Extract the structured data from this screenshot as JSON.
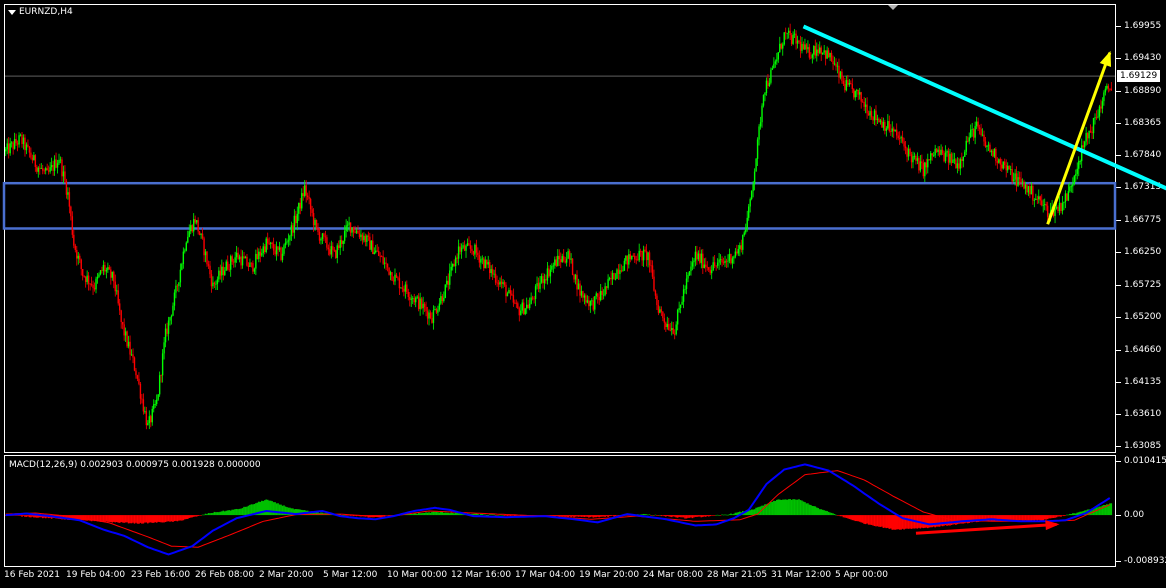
{
  "symbol": "EURNZD,H4",
  "macd_label": "MACD(12,26,9) 0.002903 0.000975 0.001928 0.000000",
  "current_price": "1.69129",
  "colors": {
    "bull": "#00ff00",
    "bear": "#ff0000",
    "resistance_line": "#00ffff",
    "zone_border": "#4a6fd0",
    "yellow_arrow": "#ffff00",
    "red_arrow": "#ff0000",
    "macd_line": "#0000ff",
    "signal_line": "#ff0000"
  },
  "chart_data": [
    {
      "type": "candlestick",
      "title": "EURNZD,H4",
      "ylim": [
        1.6299,
        1.7029
      ],
      "y_ticks": [
        "1.69955",
        "1.69430",
        "1.68890",
        "1.68365",
        "1.67840",
        "1.67315",
        "1.66775",
        "1.66250",
        "1.65725",
        "1.65200",
        "1.64660",
        "1.64135",
        "1.63610",
        "1.63085"
      ],
      "x_ticks": [
        "16 Feb 2021",
        "19 Feb 04:00",
        "23 Feb 16:00",
        "26 Feb 08:00",
        "2 Mar 20:00",
        "5 Mar 12:00",
        "10 Mar 00:00",
        "12 Mar 16:00",
        "17 Mar 04:00",
        "19 Mar 20:00",
        "24 Mar 08:00",
        "28 Mar 21:05",
        "31 Mar 12:00",
        "5 Apr 00:00"
      ],
      "path_anchors": [
        [
          0,
          1.679
        ],
        [
          10,
          1.681
        ],
        [
          20,
          1.677
        ],
        [
          28,
          1.675
        ],
        [
          36,
          1.678
        ],
        [
          42,
          1.672
        ],
        [
          46,
          1.664
        ],
        [
          52,
          1.659
        ],
        [
          60,
          1.657
        ],
        [
          66,
          1.66
        ],
        [
          73,
          1.658
        ],
        [
          78,
          1.651
        ],
        [
          88,
          1.643
        ],
        [
          96,
          1.634
        ],
        [
          102,
          1.638
        ],
        [
          108,
          1.649
        ],
        [
          115,
          1.656
        ],
        [
          122,
          1.665
        ],
        [
          128,
          1.668
        ],
        [
          134,
          1.663
        ],
        [
          140,
          1.657
        ],
        [
          148,
          1.66
        ],
        [
          156,
          1.662
        ],
        [
          166,
          1.66
        ],
        [
          176,
          1.664
        ],
        [
          186,
          1.662
        ],
        [
          196,
          1.668
        ],
        [
          202,
          1.673
        ],
        [
          210,
          1.666
        ],
        [
          222,
          1.662
        ],
        [
          232,
          1.667
        ],
        [
          242,
          1.665
        ],
        [
          252,
          1.662
        ],
        [
          264,
          1.658
        ],
        [
          276,
          1.655
        ],
        [
          288,
          1.652
        ],
        [
          298,
          1.657
        ],
        [
          306,
          1.663
        ],
        [
          316,
          1.663
        ],
        [
          326,
          1.66
        ],
        [
          336,
          1.657
        ],
        [
          346,
          1.653
        ],
        [
          354,
          1.654
        ],
        [
          362,
          1.658
        ],
        [
          372,
          1.661
        ],
        [
          380,
          1.662
        ],
        [
          388,
          1.656
        ],
        [
          396,
          1.654
        ],
        [
          404,
          1.656
        ],
        [
          414,
          1.66
        ],
        [
          424,
          1.662
        ],
        [
          434,
          1.662
        ],
        [
          440,
          1.654
        ],
        [
          446,
          1.651
        ],
        [
          452,
          1.65
        ],
        [
          458,
          1.656
        ],
        [
          466,
          1.662
        ],
        [
          476,
          1.66
        ],
        [
          486,
          1.661
        ],
        [
          496,
          1.663
        ],
        [
          502,
          1.669
        ],
        [
          508,
          1.68
        ],
        [
          512,
          1.689
        ],
        [
          518,
          1.692
        ],
        [
          526,
          1.698
        ],
        [
          534,
          1.697
        ],
        [
          542,
          1.695
        ],
        [
          550,
          1.696
        ],
        [
          558,
          1.694
        ],
        [
          566,
          1.69
        ],
        [
          576,
          1.688
        ],
        [
          586,
          1.685
        ],
        [
          596,
          1.683
        ],
        [
          604,
          1.681
        ],
        [
          612,
          1.678
        ],
        [
          620,
          1.676
        ],
        [
          628,
          1.679
        ],
        [
          636,
          1.678
        ],
        [
          644,
          1.677
        ],
        [
          650,
          1.681
        ],
        [
          656,
          1.683
        ],
        [
          662,
          1.68
        ],
        [
          670,
          1.678
        ],
        [
          680,
          1.675
        ],
        [
          690,
          1.673
        ],
        [
          698,
          1.671
        ],
        [
          705,
          1.669
        ],
        [
          712,
          1.67
        ],
        [
          718,
          1.672
        ],
        [
          724,
          1.677
        ],
        [
          730,
          1.681
        ],
        [
          736,
          1.684
        ],
        [
          742,
          1.688
        ],
        [
          747,
          1.69
        ]
      ],
      "resistance_line": {
        "start": [
          539,
          1.6994
        ],
        "end": [
          845,
          1.6664
        ]
      },
      "support_zone": {
        "top": 1.6738,
        "bottom": 1.6664
      },
      "yellow_arrow": {
        "start": [
          704,
          1.6671
        ],
        "end": [
          746,
          1.6951
        ]
      }
    },
    {
      "type": "macd",
      "title": "MACD(12,26,9) 0.002903 0.000975 0.001928 0.000000",
      "ylim": [
        -0.009832,
        0.011415
      ],
      "y_ticks": [
        "0.010415",
        "0.00",
        "-0.008932"
      ],
      "macd_anchors": [
        [
          0,
          0.0
        ],
        [
          14,
          0.0003
        ],
        [
          30,
          -0.0002
        ],
        [
          50,
          -0.001
        ],
        [
          66,
          -0.0028
        ],
        [
          80,
          -0.004
        ],
        [
          96,
          -0.0062
        ],
        [
          110,
          -0.0076
        ],
        [
          126,
          -0.006
        ],
        [
          140,
          -0.003
        ],
        [
          156,
          -0.0006
        ],
        [
          176,
          0.0008
        ],
        [
          196,
          0.0002
        ],
        [
          214,
          0.0008
        ],
        [
          226,
          -0.0002
        ],
        [
          238,
          -0.0006
        ],
        [
          250,
          -0.0008
        ],
        [
          262,
          -0.0002
        ],
        [
          276,
          0.0008
        ],
        [
          290,
          0.0014
        ],
        [
          300,
          0.001
        ],
        [
          316,
          -0.0002
        ],
        [
          338,
          -0.0004
        ],
        [
          364,
          -0.0002
        ],
        [
          384,
          -0.0008
        ],
        [
          400,
          -0.0014
        ],
        [
          420,
          0.0002
        ],
        [
          446,
          -0.0008
        ],
        [
          466,
          -0.002
        ],
        [
          480,
          -0.0018
        ],
        [
          492,
          -0.0006
        ],
        [
          502,
          0.001
        ],
        [
          514,
          0.006
        ],
        [
          526,
          0.0088
        ],
        [
          540,
          0.0098
        ],
        [
          556,
          0.0086
        ],
        [
          572,
          0.0058
        ],
        [
          590,
          0.0022
        ],
        [
          606,
          -0.0006
        ],
        [
          624,
          -0.0018
        ],
        [
          646,
          -0.0012
        ],
        [
          666,
          -0.0008
        ],
        [
          686,
          -0.0012
        ],
        [
          702,
          -0.0012
        ],
        [
          716,
          -0.001
        ],
        [
          730,
          0.0004
        ],
        [
          746,
          0.0033
        ]
      ],
      "signal_anchors": [
        [
          0,
          0.0002
        ],
        [
          20,
          0.0004
        ],
        [
          46,
          -0.0003
        ],
        [
          70,
          -0.0015
        ],
        [
          96,
          -0.0042
        ],
        [
          112,
          -0.006
        ],
        [
          130,
          -0.0062
        ],
        [
          150,
          -0.004
        ],
        [
          174,
          -0.0012
        ],
        [
          196,
          0.0001
        ],
        [
          226,
          0.0002
        ],
        [
          256,
          -0.0004
        ],
        [
          286,
          0.0008
        ],
        [
          316,
          0.0004
        ],
        [
          356,
          -0.0001
        ],
        [
          396,
          -0.0008
        ],
        [
          426,
          -0.0002
        ],
        [
          466,
          -0.0012
        ],
        [
          496,
          -0.0009
        ],
        [
          508,
          0.0002
        ],
        [
          522,
          0.004
        ],
        [
          540,
          0.0078
        ],
        [
          562,
          0.0086
        ],
        [
          580,
          0.0068
        ],
        [
          600,
          0.0036
        ],
        [
          620,
          0.0006
        ],
        [
          640,
          -0.001
        ],
        [
          670,
          -0.0012
        ],
        [
          700,
          -0.0012
        ],
        [
          722,
          -0.001
        ],
        [
          746,
          0.002
        ]
      ],
      "histogram_anchors": [
        [
          0,
          0.0
        ],
        [
          60,
          -0.0012
        ],
        [
          90,
          -0.0016
        ],
        [
          116,
          -0.0012
        ],
        [
          138,
          0.0004
        ],
        [
          158,
          0.0012
        ],
        [
          176,
          0.003
        ],
        [
          194,
          0.0012
        ],
        [
          214,
          0.0004
        ],
        [
          246,
          -0.0004
        ],
        [
          290,
          0.0006
        ],
        [
          346,
          -0.0002
        ],
        [
          400,
          -0.0004
        ],
        [
          432,
          0.0002
        ],
        [
          460,
          -0.0006
        ],
        [
          490,
          0.0002
        ],
        [
          506,
          0.0012
        ],
        [
          522,
          0.003
        ],
        [
          536,
          0.003
        ],
        [
          550,
          0.0012
        ],
        [
          566,
          -0.0004
        ],
        [
          580,
          -0.0016
        ],
        [
          600,
          -0.0028
        ],
        [
          624,
          -0.0024
        ],
        [
          660,
          -0.0012
        ],
        [
          700,
          -0.001
        ],
        [
          720,
          0.0002
        ],
        [
          734,
          0.0012
        ],
        [
          746,
          0.0022
        ]
      ],
      "red_arrow": {
        "start": [
          615,
          -0.0035
        ],
        "end": [
          710,
          -0.0018
        ]
      }
    }
  ]
}
